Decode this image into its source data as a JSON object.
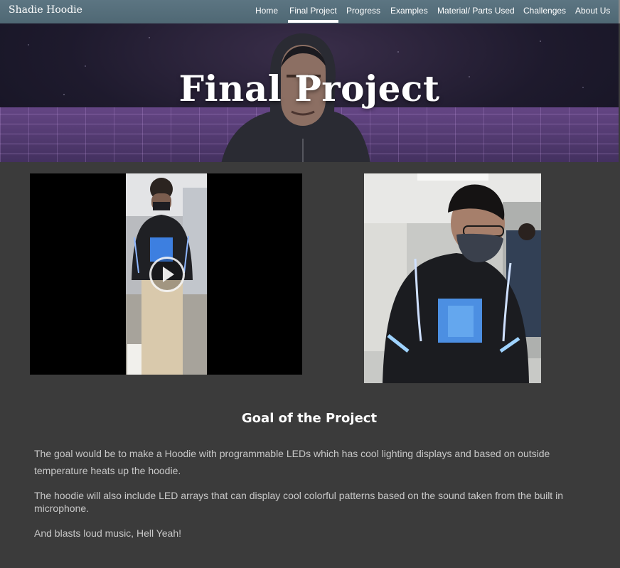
{
  "site": {
    "brand": "Shadie Hoodie"
  },
  "nav": {
    "items": [
      {
        "label": "Home"
      },
      {
        "label": "Final Project",
        "active": true
      },
      {
        "label": "Progress"
      },
      {
        "label": "Examples"
      },
      {
        "label": "Material/ Parts Used"
      },
      {
        "label": "Challenges"
      },
      {
        "label": "About Us"
      }
    ]
  },
  "hero": {
    "title": "Final Project"
  },
  "media": {
    "video": {
      "icon": "play-icon"
    },
    "photo": {
      "icon": "led-hoodie-photo"
    }
  },
  "content": {
    "heading": "Goal of the Project",
    "paragraphs": [
      "The goal would be to make a Hoodie with programmable LEDs which has cool lighting displays and based on outside temperature heats up the hoodie.",
      "The hoodie will also include LED arrays that can display cool colorful patterns based on the sound taken from the built in microphone.",
      "And blasts loud music, Hell Yeah!"
    ]
  },
  "colors": {
    "navbar": "#56707c",
    "page_background": "#3b3b3b",
    "text": "#c8c8c8",
    "accent": "#ffffff"
  }
}
